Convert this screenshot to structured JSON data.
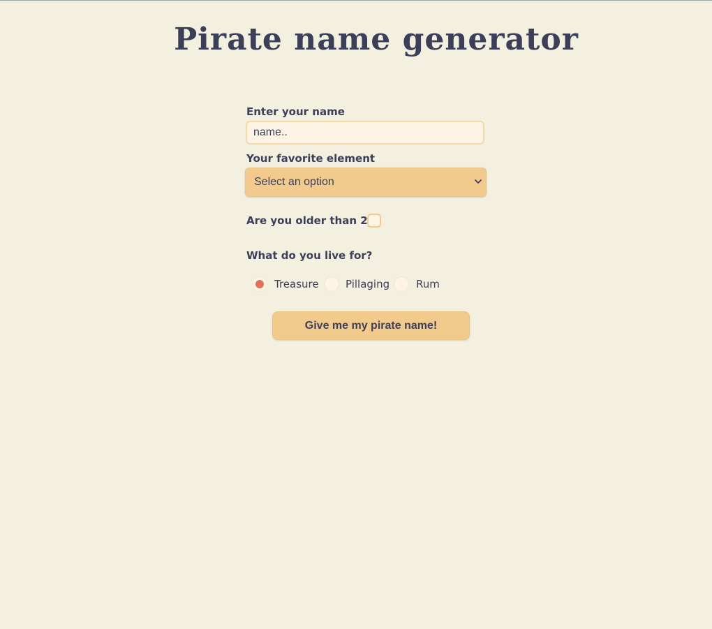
{
  "page": {
    "title": "Pirate name generator"
  },
  "form": {
    "name_label": "Enter your name",
    "name_placeholder": "name..",
    "name_value": "",
    "element_label": "Your favorite element",
    "element_selected": "Select an option",
    "age_label": "Are you older than 25?",
    "age_checked": false,
    "live_for_label": "What do you live for?",
    "live_for_options": [
      {
        "label": "Treasure",
        "checked": true
      },
      {
        "label": "Pillaging",
        "checked": false
      },
      {
        "label": "Rum",
        "checked": false
      }
    ],
    "submit_label": "Give me my pirate name!"
  },
  "colors": {
    "background": "#f3f0df",
    "text": "#3b3f5a",
    "accent": "#f2cb8c",
    "input_bg": "#fdf4e6",
    "radio_selected": "#e07456"
  },
  "icons": {
    "select_arrow": "chevron-down-icon"
  }
}
